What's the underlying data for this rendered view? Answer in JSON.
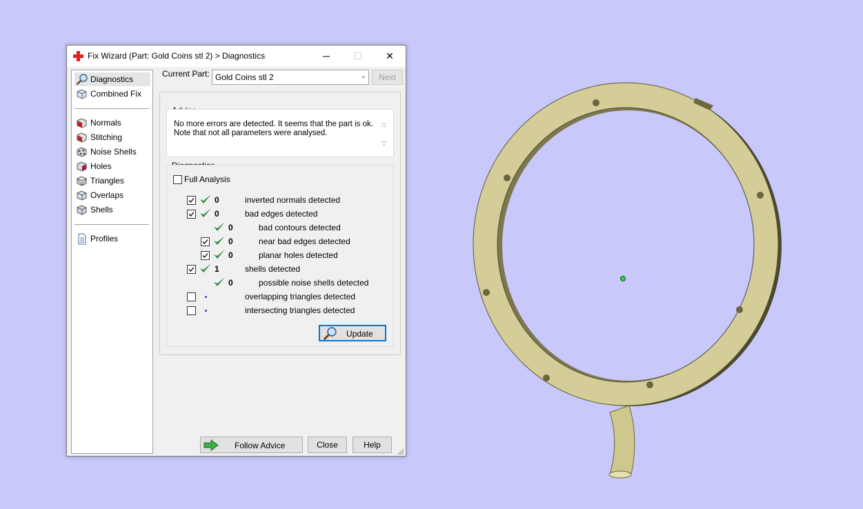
{
  "window": {
    "title": "Fix Wizard (Part: Gold Coins stl 2) > Diagnostics",
    "controls": [
      "─",
      "☐",
      "✕"
    ]
  },
  "nav": {
    "items": [
      {
        "label": "Diagnostics",
        "icon": "magnifier-icon"
      },
      {
        "label": "Combined Fix",
        "icon": "cube-icon"
      },
      {
        "label": "Normals",
        "icon": "normals-icon"
      },
      {
        "label": "Stitching",
        "icon": "stitching-icon"
      },
      {
        "label": "Noise Shells",
        "icon": "noise-shells-icon"
      },
      {
        "label": "Holes",
        "icon": "holes-icon"
      },
      {
        "label": "Triangles",
        "icon": "triangles-icon"
      },
      {
        "label": "Overlaps",
        "icon": "overlaps-icon"
      },
      {
        "label": "Shells",
        "icon": "shells-icon"
      },
      {
        "label": "Profiles",
        "icon": "document-icon"
      }
    ]
  },
  "current_part": {
    "label": "Current Part:",
    "value": "Gold Coins stl 2",
    "next_label": "Next"
  },
  "advice": {
    "title": "Advice",
    "line1": "No more errors are detected. It seems that the part is ok.",
    "line2": "Note that not all parameters were analysed."
  },
  "diagnostics": {
    "title": "Diagnostics",
    "full_analysis": "Full Analysis",
    "rows": [
      {
        "count": "0",
        "label": "inverted normals detected"
      },
      {
        "count": "0",
        "label": "bad edges detected"
      },
      {
        "count": "0",
        "label": "bad contours detected"
      },
      {
        "count": "0",
        "label": "near bad edges detected"
      },
      {
        "count": "0",
        "label": "planar holes detected"
      },
      {
        "count": "1",
        "label": "shells detected"
      },
      {
        "count": "0",
        "label": "possible noise shells detected"
      },
      {
        "count": "",
        "label": "overlapping triangles detected"
      },
      {
        "count": "",
        "label": "intersecting triangles detected"
      }
    ],
    "update_label": "Update"
  },
  "footer": {
    "follow_advice": "Follow Advice",
    "close": "Close",
    "help": "Help"
  },
  "colors": {
    "background": "#c8c8fa",
    "ring": "#d8d09a",
    "check_green": "#2e8b3e",
    "accent": "#0078d7"
  }
}
